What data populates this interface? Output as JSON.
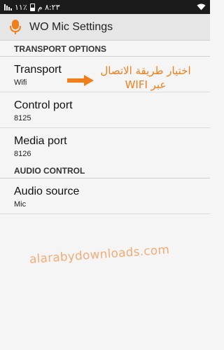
{
  "status_bar": {
    "time": "٨:٢٣ م",
    "battery": "٪١١",
    "icons": [
      "battery-icon",
      "signal-icon",
      "wifi-icon"
    ]
  },
  "app_bar": {
    "title": "WO Mic Settings",
    "icon": "microphone-icon",
    "accent": "#f07f1b"
  },
  "sections": [
    {
      "header": "TRANSPORT OPTIONS",
      "items": [
        {
          "title": "Transport",
          "summary": "Wifi"
        },
        {
          "title": "Control port",
          "summary": "8125"
        },
        {
          "title": "Media port",
          "summary": "8126"
        }
      ]
    },
    {
      "header": "AUDIO CONTROL",
      "items": [
        {
          "title": "Audio source",
          "summary": "Mic"
        }
      ]
    }
  ],
  "annotation": {
    "line1": "اختيار طريقة الاتصال",
    "line2": "عبر WIFI",
    "color": "#f07f1b"
  },
  "watermark": "alarabydownloads.com"
}
